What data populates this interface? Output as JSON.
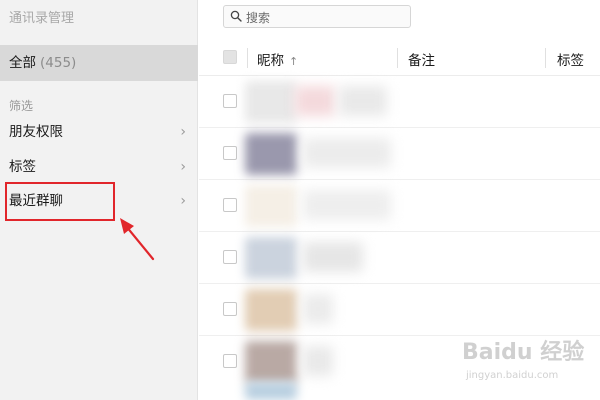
{
  "sidebar": {
    "title": "通讯录管理",
    "all_label": "全部",
    "all_count": "(455)",
    "filter_label": "筛选",
    "items": [
      {
        "label": "朋友权限",
        "chevron": "›"
      },
      {
        "label": "标签",
        "chevron": "›"
      },
      {
        "label": "最近群聊",
        "chevron": "›"
      }
    ]
  },
  "search": {
    "placeholder": "搜索",
    "icon": "search-icon"
  },
  "table": {
    "columns": [
      "昵称",
      "备注",
      "标签"
    ],
    "sort_indicator": "↑",
    "row_count_visible": 6
  },
  "annotation": {
    "highlight_color": "#e1262b"
  },
  "watermark": {
    "brand": "Baidu 经验",
    "domain": "jingyan.baidu.com"
  }
}
